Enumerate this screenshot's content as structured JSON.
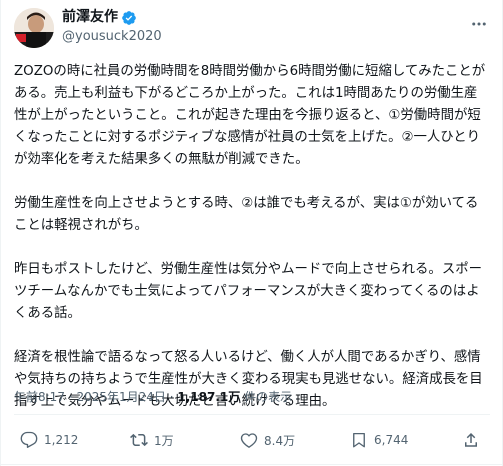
{
  "author": {
    "display_name": "前澤友作",
    "handle": "@yousuck2020",
    "avatar_icon": "user-avatar",
    "verified_icon": "verified-badge-icon",
    "verified_color": "#1d9bf0"
  },
  "tweet": {
    "paragraphs": [
      "ZOZOの時に社員の労働時間を8時間労働から6時間労働に短縮してみたことがある。売上も利益も下がるどころか上がった。これは1時間あたりの労働生産性が上がったということ。これが起きた理由を今振り返ると、①労働時間が短くなったことに対するポジティブな感情が社員の士気を上げた。②一人ひとりが効率化を考えた結果多くの無駄が削減できた。",
      "労働生産性を向上させようとする時、②は誰でも考えるが、実は①が効いてることは軽視されがち。",
      "昨日もポストしたけど、労働生産性は気分やムードで向上させられる。スポーツチームなんかでも士気によってパフォーマンスが大きく変わってくるのはよくある話。",
      "経済を根性論で語るなって怒る人いるけど、働く人が人間であるかぎり、感情や気持ちの持ちようで生産性が大きく変わる現実も見逃せない。経済成長を目指す上で気分やムードも大切だと言い続けてる理由。"
    ],
    "time": "午前8:17",
    "separator": "·",
    "date": "2025年1月24日",
    "views_count": "1,187.1万",
    "views_label": "件の表示"
  },
  "actions": {
    "reply_count": "1,212",
    "repost_count": "1万",
    "like_count": "8.4万",
    "bookmark_count": "6,744"
  },
  "icons": {
    "more": "more-options-icon",
    "reply": "reply-icon",
    "repost": "repost-icon",
    "like": "like-heart-icon",
    "bookmark": "bookmark-icon",
    "share": "share-icon"
  },
  "colors": {
    "text": "#0f1419",
    "secondary": "#536471",
    "accent": "#1d9bf0",
    "divider": "#eff3f4"
  }
}
